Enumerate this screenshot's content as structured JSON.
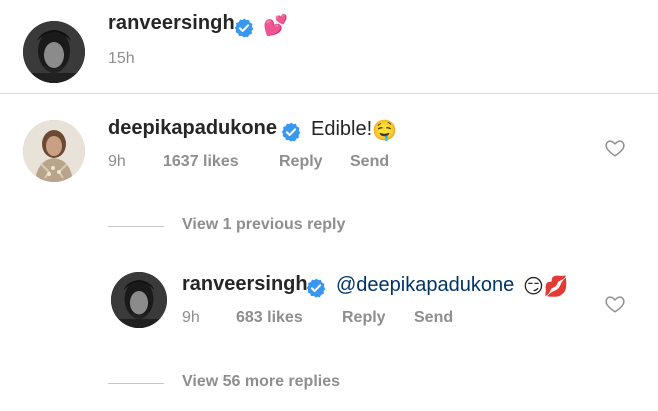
{
  "caption": {
    "username": "ranveersingh",
    "verified_icon": "verified-badge-icon",
    "emoji": "💕",
    "time": "15h"
  },
  "comment": {
    "username": "deepikapadukone",
    "text": "Edible!",
    "emoji": "🤤",
    "time": "9h",
    "likes": "1637 likes",
    "reply_label": "Reply",
    "send_label": "Send",
    "like_icon": "heart-outline-icon"
  },
  "view_previous": {
    "label": "View 1 previous reply"
  },
  "reply": {
    "username": "ranveersingh",
    "mention": "@deepikapadukone",
    "emoji": "😏💋",
    "time": "9h",
    "likes": "683 likes",
    "reply_label": "Reply",
    "send_label": "Send",
    "like_icon": "heart-outline-icon"
  },
  "view_more": {
    "label": "View 56 more replies"
  },
  "colors": {
    "verified": "#3897f0",
    "text": "#262626",
    "muted": "#8e8e8e",
    "mention": "#003569",
    "divider": "#dbdbdb"
  }
}
